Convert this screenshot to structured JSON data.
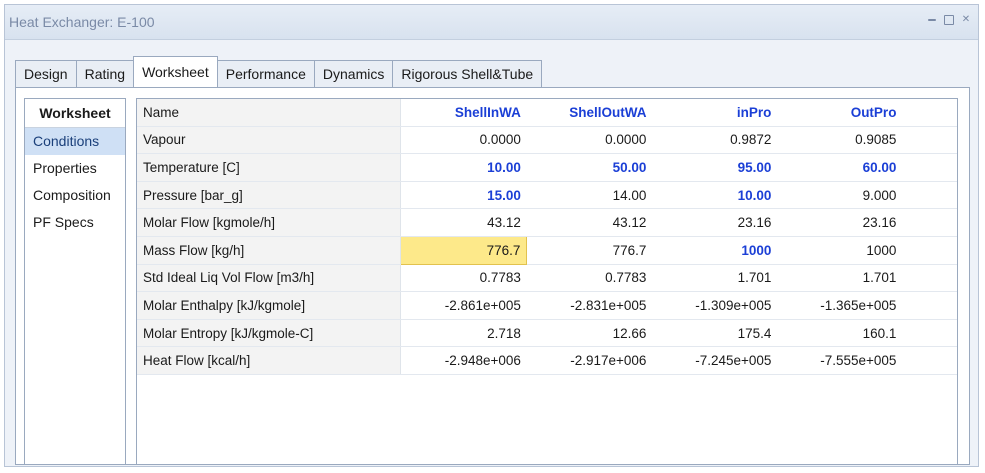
{
  "window": {
    "title": "Heat Exchanger: E-100"
  },
  "tabs": [
    "Design",
    "Rating",
    "Worksheet",
    "Performance",
    "Dynamics",
    "Rigorous Shell&Tube"
  ],
  "active_tab": "Worksheet",
  "side": {
    "title": "Worksheet",
    "items": [
      "Conditions",
      "Properties",
      "Composition",
      "PF Specs"
    ],
    "selected": "Conditions"
  },
  "grid": {
    "header": {
      "label": "Name",
      "cols": [
        "ShellInWA",
        "ShellOutWA",
        "inPro",
        "OutPro"
      ]
    },
    "rows": [
      {
        "label": "Vapour",
        "values": [
          "0.0000",
          "0.0000",
          "0.9872",
          "0.9085"
        ]
      },
      {
        "label": "Temperature [C]",
        "values": [
          "10.00",
          "50.00",
          "95.00",
          "60.00"
        ]
      },
      {
        "label": "Pressure [bar_g]",
        "values": [
          "15.00",
          "14.00",
          "10.00",
          "9.000"
        ]
      },
      {
        "label": "Molar Flow [kgmole/h]",
        "values": [
          "43.12",
          "43.12",
          "23.16",
          "23.16"
        ]
      },
      {
        "label": "Mass Flow [kg/h]",
        "values": [
          "776.7",
          "776.7",
          "1000",
          "1000"
        ]
      },
      {
        "label": "Std Ideal Liq Vol Flow [m3/h]",
        "values": [
          "0.7783",
          "0.7783",
          "1.701",
          "1.701"
        ]
      },
      {
        "label": "Molar Enthalpy [kJ/kgmole]",
        "values": [
          "-2.861e+005",
          "-2.831e+005",
          "-1.309e+005",
          "-1.365e+005"
        ]
      },
      {
        "label": "Molar Entropy [kJ/kgmole-C]",
        "values": [
          "2.718",
          "12.66",
          "175.4",
          "160.1"
        ]
      },
      {
        "label": "Heat Flow [kcal/h]",
        "values": [
          "-2.948e+006",
          "-2.917e+006",
          "-7.245e+005",
          "-7.555e+005"
        ]
      }
    ]
  },
  "colors": {
    "spec_value": "#1b3fd6",
    "highlight_cell": "#fde98a",
    "selected_item": "#cfe0f5"
  }
}
